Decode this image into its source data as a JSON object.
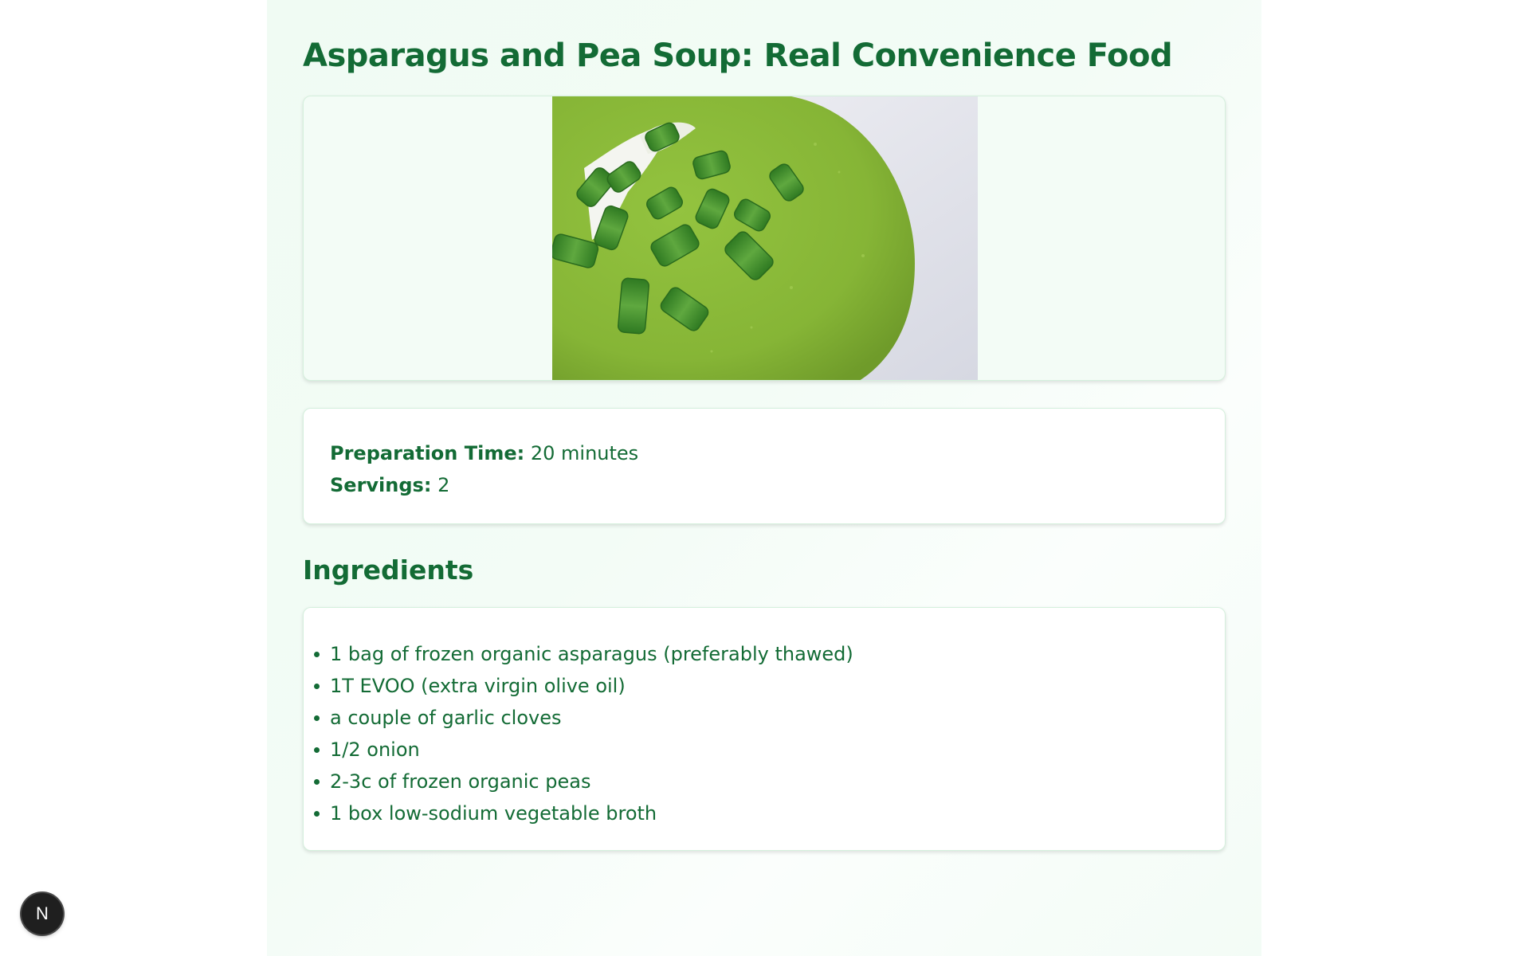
{
  "recipe": {
    "title": "Asparagus and Pea Soup: Real Convenience Food",
    "image_alt": "Asparagus and pea soup topped with chopped chives and sour cream",
    "prep_time_label": "Preparation Time:",
    "prep_time_value": "20 minutes",
    "servings_label": "Servings:",
    "servings_value": "2",
    "ingredients_heading": "Ingredients",
    "ingredients": [
      "1 bag of frozen organic asparagus (preferably thawed)",
      "1T EVOO (extra virgin olive oil)",
      "a couple of garlic cloves",
      "1/2 onion",
      "2-3c of frozen organic peas",
      "1 box low-sodium vegetable broth"
    ]
  },
  "badge": {
    "letter": "N",
    "icon": "nextjs-logo-icon"
  },
  "colors": {
    "accent": "#136b35",
    "page_bg": "#f3fcf6",
    "card_border": "#d5f0dd",
    "soup_green": "#8cbb3a",
    "chive_green": "#3f8b2c"
  }
}
